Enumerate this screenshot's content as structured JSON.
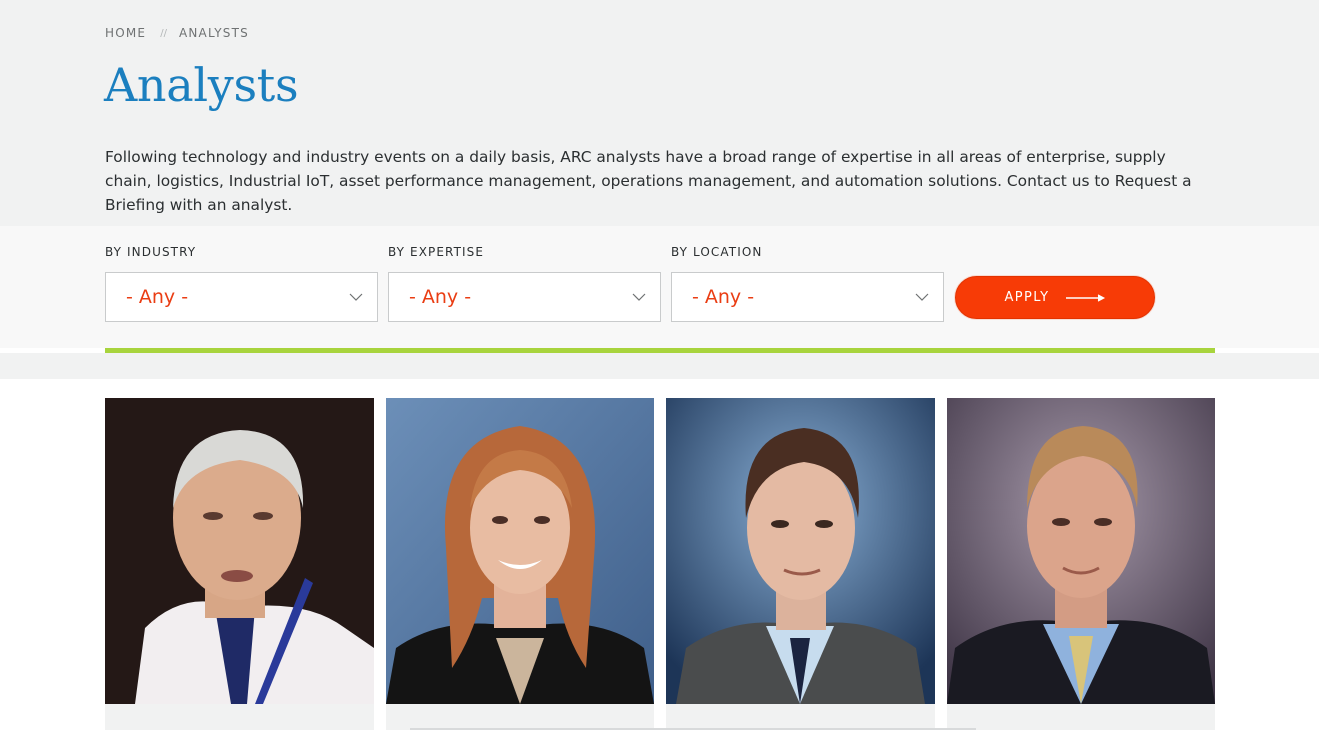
{
  "breadcrumb": {
    "home": "HOME",
    "separator": "//",
    "current": "ANALYSTS"
  },
  "page": {
    "title": "Analysts",
    "intro": "Following technology and industry events on a daily basis, ARC analysts have a broad range of expertise in all areas of enterprise, supply chain, logistics, Industrial IoT, asset performance management, operations management, and automation solutions. Contact us to Request a Briefing with an analyst."
  },
  "filters": {
    "industry": {
      "label": "BY INDUSTRY",
      "value": "- Any -"
    },
    "expertise": {
      "label": "BY EXPERTISE",
      "value": "- Any -"
    },
    "location": {
      "label": "BY LOCATION",
      "value": "- Any -"
    },
    "apply_label": "APPLY"
  },
  "icons": {
    "dropdown": "chevron-down-icon",
    "apply": "arrow-right-icon"
  },
  "colors": {
    "title_blue": "#1b7fbf",
    "accent_orange": "#f73b06",
    "select_text": "#ea3d13",
    "accent_green": "#a8d43d",
    "page_gray": "#f1f2f2"
  }
}
